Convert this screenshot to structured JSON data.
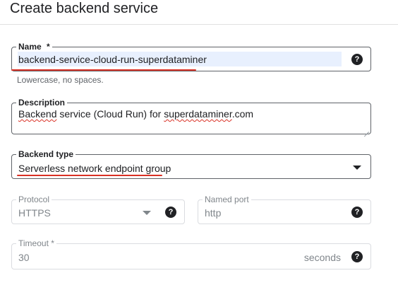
{
  "page": {
    "title": "Create backend service"
  },
  "name_field": {
    "label": "Name",
    "required_mark": "*",
    "value": "backend-service-cloud-run-superdataminer",
    "hint": "Lowercase, no spaces.",
    "help_icon": "help-circle-icon"
  },
  "description_field": {
    "label": "Description",
    "value_prefix": "Backend",
    "value_middle": " service (Cloud Run) for ",
    "value_link": "superdataminer",
    "value_suffix": ".com"
  },
  "backend_type_field": {
    "label": "Backend type",
    "value": "Serverless network endpoint group",
    "dropdown_icon": "arrow-drop-down-icon"
  },
  "protocol_field": {
    "label": "Protocol",
    "value": "HTTPS",
    "dropdown_icon": "arrow-drop-down-icon",
    "help_icon": "help-circle-icon"
  },
  "named_port_field": {
    "label": "Named port",
    "value": "http",
    "help_icon": "help-circle-icon"
  },
  "timeout_field": {
    "label": "Timeout *",
    "value": "30",
    "unit": "seconds",
    "help_icon": "help-circle-icon"
  },
  "colors": {
    "annotation_red": "#d93025",
    "text_selection": "#e8f0fe",
    "border_active": "#5f6368",
    "border_disabled": "#dadce0"
  }
}
